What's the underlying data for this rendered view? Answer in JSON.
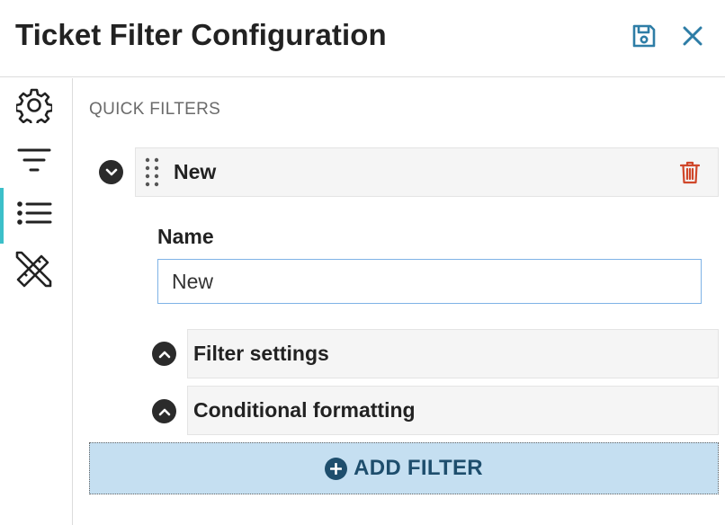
{
  "header": {
    "title": "Ticket Filter Configuration",
    "icons": {
      "save": "save-icon",
      "close": "close-icon"
    }
  },
  "sidebar": {
    "items": [
      {
        "name": "settings",
        "icon": "gear-icon",
        "active": false
      },
      {
        "name": "filter",
        "icon": "filter-icon",
        "active": false
      },
      {
        "name": "list",
        "icon": "list-icon",
        "active": true
      },
      {
        "name": "tools",
        "icon": "ruler-pencil-icon",
        "active": false
      }
    ],
    "active_color": "#3cbfc9"
  },
  "main": {
    "section_title": "QUICK FILTERS",
    "filter": {
      "name": "New",
      "expanded": true,
      "name_label": "Name",
      "name_value": "New",
      "panels": [
        {
          "label": "Filter settings",
          "expanded": false
        },
        {
          "label": "Conditional formatting",
          "expanded": false
        }
      ]
    },
    "add_filter_label": "ADD FILTER"
  },
  "colors": {
    "accent": "#2e7da6",
    "delete": "#d0472a",
    "add_bg": "#c5dff1",
    "add_text": "#1e4e6d"
  }
}
